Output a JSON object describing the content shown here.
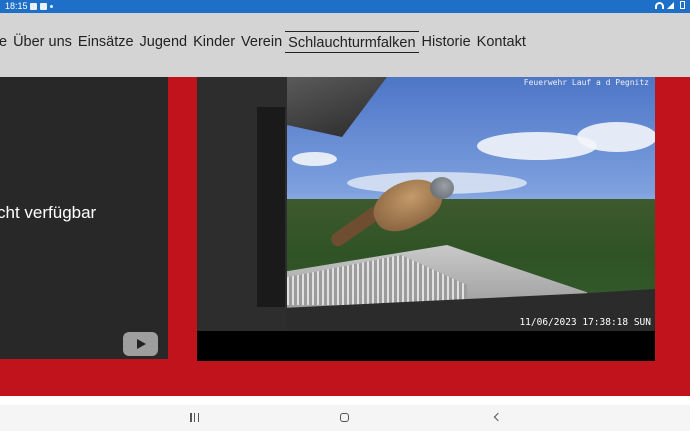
{
  "status_bar": {
    "time": "18:15",
    "battery_level": "",
    "icons": [
      "gallery-icon",
      "image-icon",
      "dot-icon",
      "wifi-icon",
      "signal-icon",
      "battery-icon"
    ]
  },
  "nav": {
    "items": [
      {
        "label": "e"
      },
      {
        "label": "Über uns"
      },
      {
        "label": "Einsätze"
      },
      {
        "label": "Jugend"
      },
      {
        "label": "Kinder"
      },
      {
        "label": "Verein"
      },
      {
        "label": "Schlauchturmfalken",
        "active": true
      },
      {
        "label": "Historie"
      },
      {
        "label": "Kontakt"
      }
    ]
  },
  "youtube_panel": {
    "message": "cht verfügbar"
  },
  "webcam": {
    "overlay_top": "Feuerwehr Lauf a d Pegnitz",
    "overlay_bottom": "11/06/2023 17:38:18 SUN"
  },
  "colors": {
    "brand_red": "#c1131b",
    "status_bar_blue": "#1e6fc8",
    "header_grey": "#d4d4d4"
  }
}
